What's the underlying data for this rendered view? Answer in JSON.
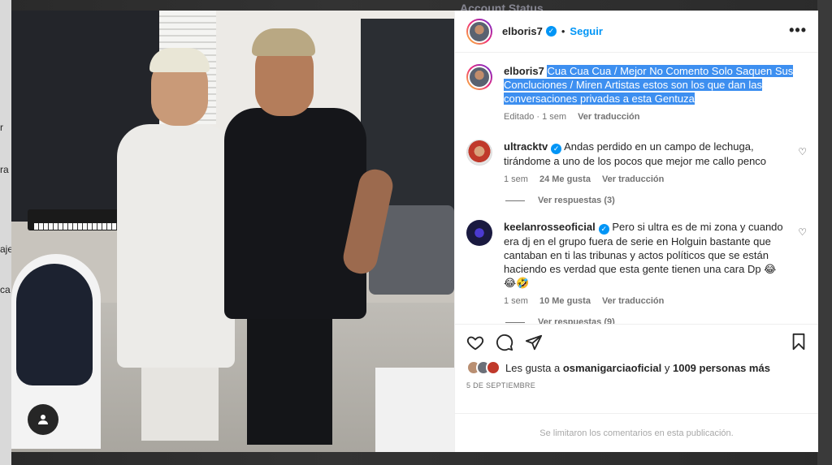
{
  "background": {
    "top_text": "Account Status",
    "left_letters": [
      "r",
      "ra",
      "aje",
      "ca"
    ]
  },
  "post": {
    "author": "elboris7",
    "follow_label": "Seguir",
    "separator": "•",
    "more_icon": "more-horizontal-icon",
    "caption": {
      "username": "elboris7",
      "text": "Cua Cua Cua / Mejor No Comento Solo Saquen Sus Concluciones / Miren Artistas estos son los que dan las conversaciones privadas a esta Gentuza",
      "meta_edited": "Editado",
      "meta_time": "1 sem",
      "translate": "Ver traducción"
    },
    "comments": [
      {
        "username": "ultracktv",
        "verified": true,
        "text": "Andas perdido en un campo de lechuga, tirándome a uno de los pocos que mejor me callo penco",
        "time": "1 sem",
        "likes": "24 Me gusta",
        "translate": "Ver traducción",
        "replies": "Ver respuestas (3)"
      },
      {
        "username": "keelanrosseoficial",
        "verified": true,
        "text": "Pero si ultra es de mi zona y cuando era dj en el grupo fuera de serie en Holguin bastante que cantaban en ti las tribunas y actos políticos que se están haciendo es verdad que esta gente tienen una cara Dp 😂😂🤣",
        "time": "1 sem",
        "likes": "10 Me gusta",
        "translate": "Ver traducción",
        "replies": "Ver respuestas (9)"
      }
    ],
    "likes_prefix": "Les gusta a",
    "likes_user": "osmanigarciaoficial",
    "likes_join": "y",
    "likes_count": "1009 personas más",
    "date": "5 DE SEPTIEMBRE",
    "comments_disabled": "Se limitaron los comentarios en esta publicación."
  },
  "colors": {
    "link": "#0095f6",
    "selection": "#3d8ff0",
    "muted": "#737373"
  }
}
